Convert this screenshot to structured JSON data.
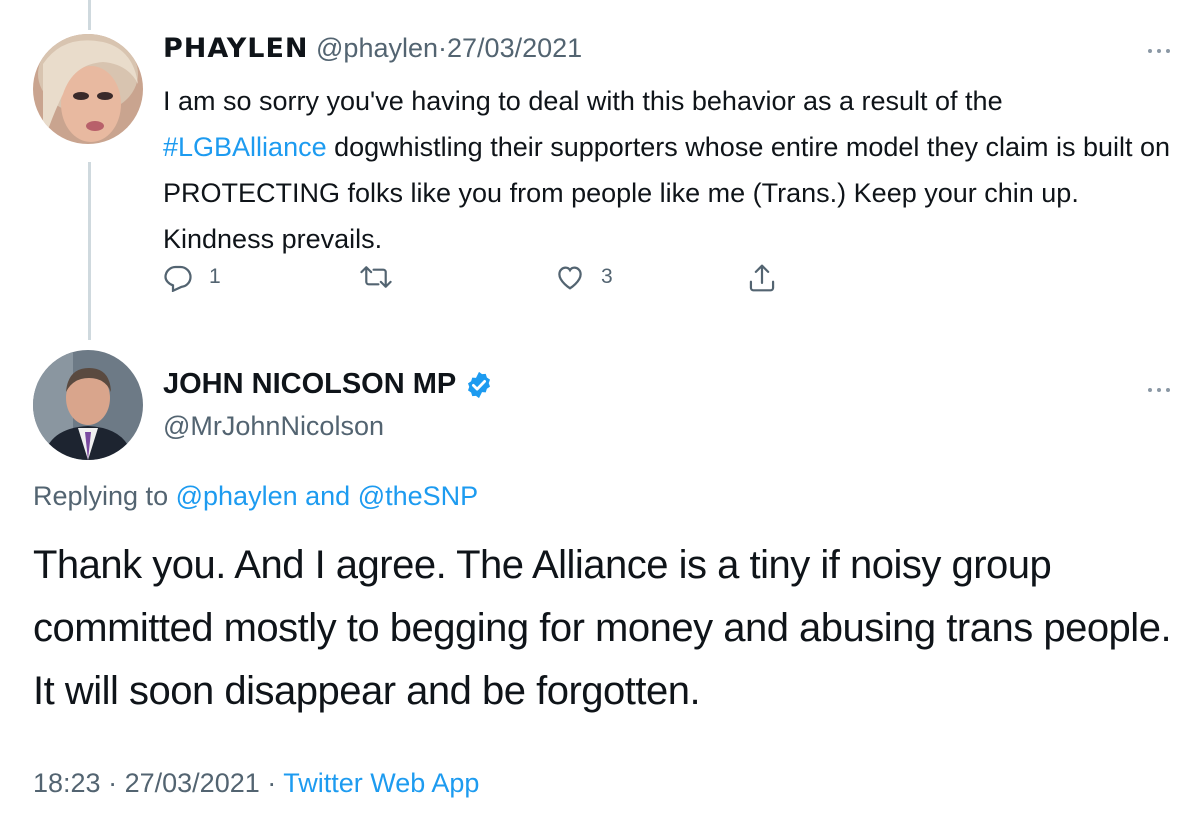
{
  "reply_tweet": {
    "display_name": "PHAYLEN",
    "handle": "@phaylen",
    "separator": "·",
    "date": "27/03/2021",
    "text_before_tag": "I am so sorry you've having to deal with this behavior as a result of the ",
    "hashtag": "#LGBAlliance",
    "text_after_tag": " dogwhistling their supporters whose entire model they claim is built on PROTECTING folks like you from people like me (Trans.) Keep your chin up. Kindness prevails.",
    "actions": {
      "reply_count": "1",
      "retweet_count": "",
      "like_count": "3"
    },
    "icons": [
      "reply-icon",
      "retweet-icon",
      "like-icon",
      "share-icon",
      "more-icon"
    ]
  },
  "main_tweet": {
    "display_name": "JOHN NICOLSON MP",
    "verified": true,
    "handle": "@MrJohnNicolson",
    "replying_prefix": "Replying to",
    "replying_user1": "@phaylen",
    "replying_and": "and",
    "replying_user2": "@theSNP",
    "text": "Thank you. And I agree. The Alliance is a tiny if noisy group committed mostly to begging for money and abusing trans people. It will soon disappear and be forgotten.",
    "time": "18:23",
    "separator": "·",
    "date": "27/03/2021",
    "source": "Twitter Web App"
  },
  "colors": {
    "accent": "#1d9bf0",
    "muted": "#536471",
    "text": "#0f1419",
    "thread_line": "#cfd9de"
  }
}
